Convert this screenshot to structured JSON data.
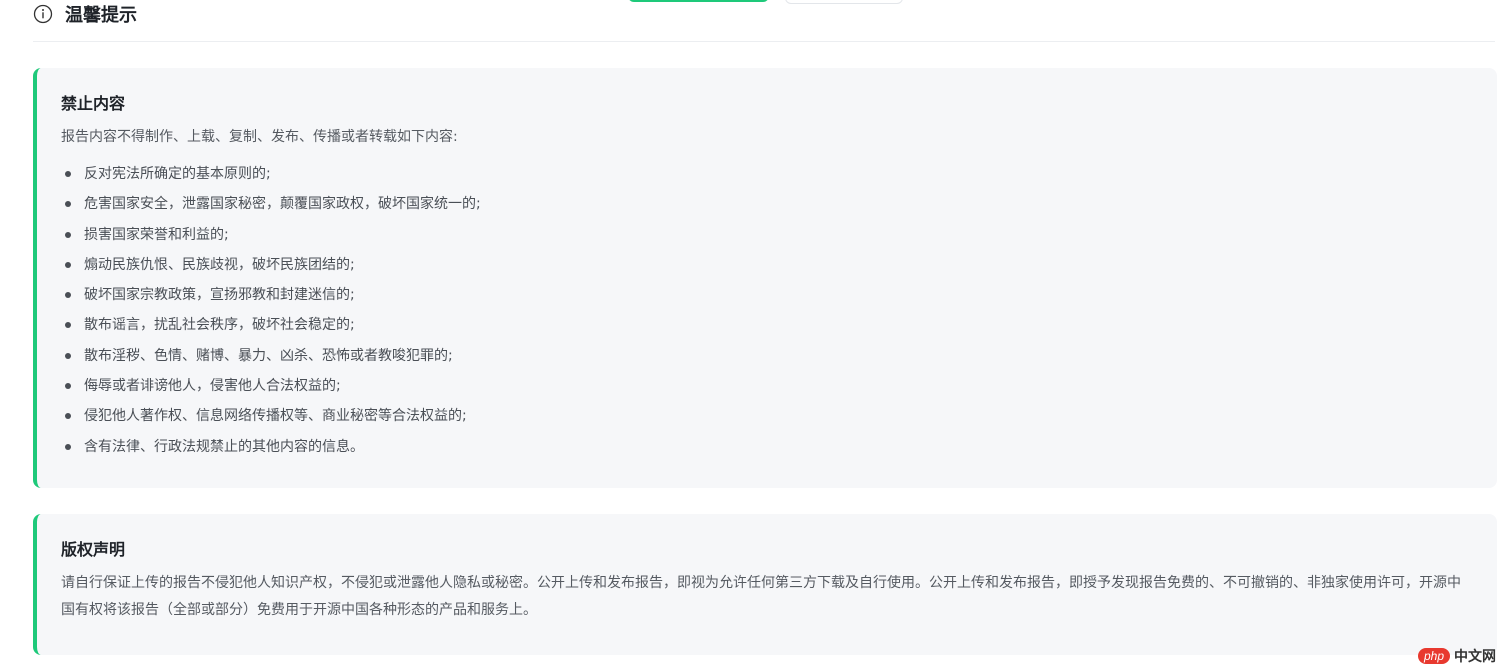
{
  "header": {
    "title": "温馨提示",
    "icon": "info-icon"
  },
  "cards": [
    {
      "title": "禁止内容",
      "desc": "报告内容不得制作、上载、复制、发布、传播或者转载如下内容:",
      "items": [
        "反对宪法所确定的基本原则的;",
        "危害国家安全，泄露国家秘密，颠覆国家政权，破坏国家统一的;",
        "损害国家荣誉和利益的;",
        "煽动民族仇恨、民族歧视，破坏民族团结的;",
        "破坏国家宗教政策，宣扬邪教和封建迷信的;",
        "散布谣言，扰乱社会秩序，破坏社会稳定的;",
        "散布淫秽、色情、赌博、暴力、凶杀、恐怖或者教唆犯罪的;",
        "侮辱或者诽谤他人，侵害他人合法权益的;",
        "侵犯他人著作权、信息网络传播权等、商业秘密等合法权益的;",
        "含有法律、行政法规禁止的其他内容的信息。"
      ]
    },
    {
      "title": "版权声明",
      "body": "请自行保证上传的报告不侵犯他人知识产权，不侵犯或泄露他人隐私或秘密。公开上传和发布报告，即视为允许任何第三方下载及自行使用。公开上传和发布报告，即授予发现报告免费的、不可撤销的、非独家使用许可，开源中国有权将该报告（全部或部分）免费用于开源中国各种形态的产品和服务上。"
    }
  ],
  "watermark": {
    "badge": "php",
    "text": "中文网"
  },
  "colors": {
    "accent": "#1ec97a",
    "card_bg": "#f6f7f9"
  }
}
